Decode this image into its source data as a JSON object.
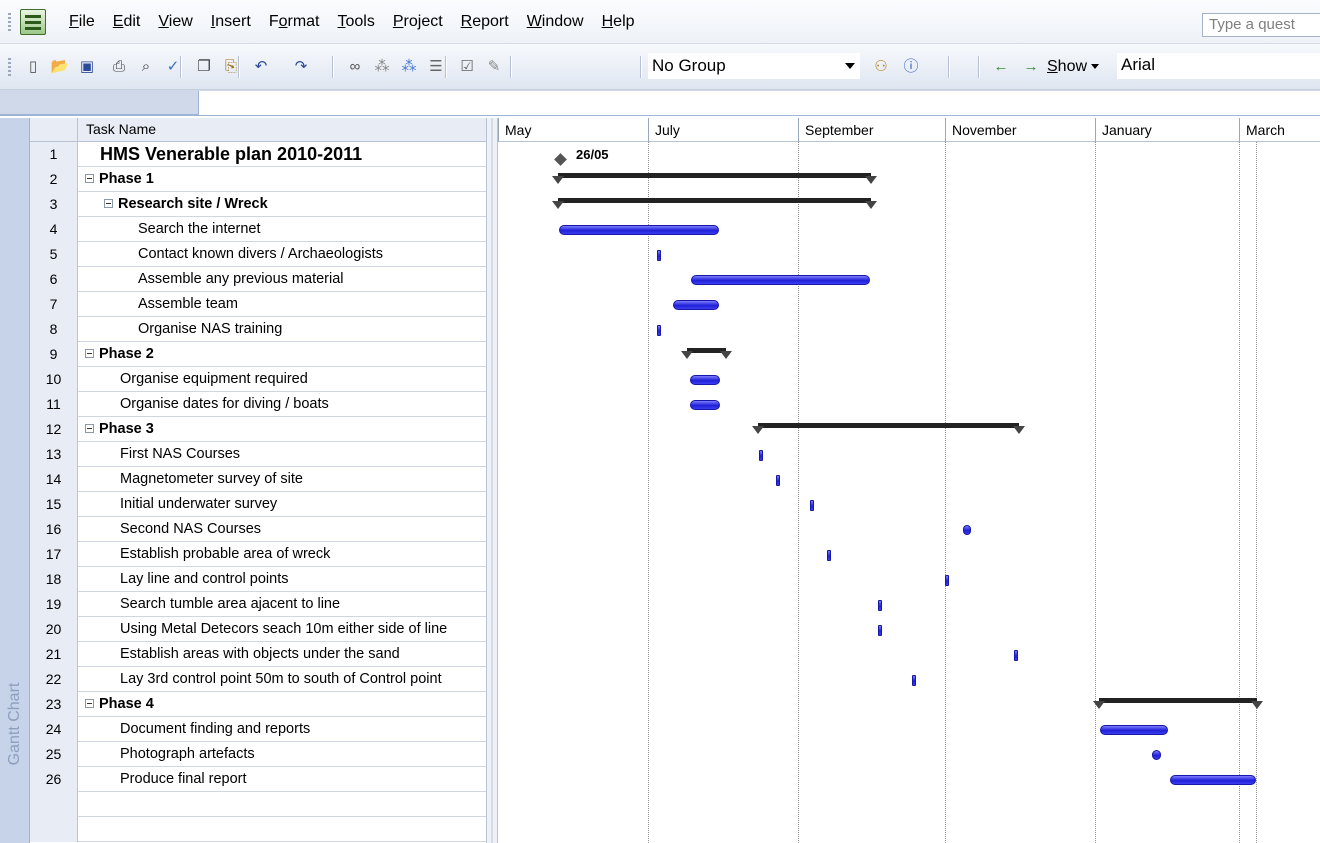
{
  "menu": {
    "items": [
      {
        "key": "F",
        "rest": "ile"
      },
      {
        "key": "E",
        "rest": "dit"
      },
      {
        "key": "V",
        "rest": "iew"
      },
      {
        "key": "I",
        "rest": "nsert"
      },
      {
        "pre": "F",
        "key": "o",
        "rest": "rmat"
      },
      {
        "key": "T",
        "rest": "ools"
      },
      {
        "key": "P",
        "rest": "roject"
      },
      {
        "key": "R",
        "rest": "eport"
      },
      {
        "key": "W",
        "rest": "indow"
      },
      {
        "key": "H",
        "rest": "elp"
      }
    ],
    "help_search_placeholder": "Type a quest"
  },
  "toolbar": {
    "group_value": "No Group",
    "show_key": "S",
    "show_rest": "how",
    "font_value": "Arial",
    "icons": [
      "new-icon",
      "open-icon",
      "save-icon",
      "print-icon",
      "print-preview-icon",
      "spelling-icon",
      "copy-icon",
      "paste-icon",
      "undo-icon",
      "redo-icon",
      "hyperlink-icon",
      "link-tasks-icon",
      "unlink-tasks-icon",
      "split-task-icon",
      "task-info-icon",
      "notes-icon",
      "assign-resources-icon",
      "help-icon",
      "outdent-icon",
      "indent-icon"
    ]
  },
  "sheet": {
    "column_header": "Task Name",
    "rows": [
      {
        "id": "1",
        "name": "HMS Venerable plan 2010-2011"
      },
      {
        "id": "2",
        "name": "Phase 1"
      },
      {
        "id": "3",
        "name": "Research site / Wreck"
      },
      {
        "id": "4",
        "name": "Search the internet"
      },
      {
        "id": "5",
        "name": "Contact known divers / Archaeologists"
      },
      {
        "id": "6",
        "name": "Assemble any previous material"
      },
      {
        "id": "7",
        "name": "Assemble team"
      },
      {
        "id": "8",
        "name": "Organise NAS training"
      },
      {
        "id": "9",
        "name": "Phase 2"
      },
      {
        "id": "10",
        "name": "Organise equipment required"
      },
      {
        "id": "11",
        "name": "Organise dates for diving / boats"
      },
      {
        "id": "12",
        "name": "Phase 3"
      },
      {
        "id": "13",
        "name": "First NAS Courses"
      },
      {
        "id": "14",
        "name": "Magnetometer survey of site"
      },
      {
        "id": "15",
        "name": "Initial underwater survey"
      },
      {
        "id": "16",
        "name": "Second NAS Courses"
      },
      {
        "id": "17",
        "name": "Establish probable area of wreck"
      },
      {
        "id": "18",
        "name": "Lay line and control points"
      },
      {
        "id": "19",
        "name": "Search tumble area ajacent to line"
      },
      {
        "id": "20",
        "name": "Using Metal Detecors seach 10m either side of line"
      },
      {
        "id": "21",
        "name": "Establish areas with objects under the sand"
      },
      {
        "id": "22",
        "name": "Lay 3rd control point 50m to south of Control point"
      },
      {
        "id": "23",
        "name": "Phase 4"
      },
      {
        "id": "24",
        "name": "Document finding and reports"
      },
      {
        "id": "25",
        "name": "Photograph artefacts"
      },
      {
        "id": "26",
        "name": "Produce final report"
      }
    ]
  },
  "view_bar_label": "Gantt Chart",
  "timescale": [
    "May",
    "July",
    "September",
    "November",
    "January",
    "March"
  ],
  "milestone_label": "26/05",
  "colors": {
    "task_bar": "#3030e8",
    "summary_bar": "#222222",
    "header_bg": "#e8edf5",
    "view_bar": "#c6d3e8"
  }
}
